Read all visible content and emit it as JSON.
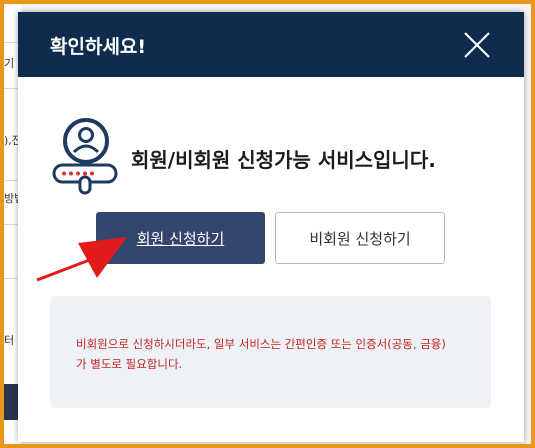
{
  "background_page": {
    "fragments": [
      "기",
      "),잔",
      "방법",
      "터"
    ]
  },
  "modal": {
    "title": "확인하세요!",
    "close_icon": "close-x-icon",
    "hero_icon": "user-password-icon",
    "message": "회원/비회원 신청가능 서비스입니다.",
    "buttons": {
      "member": "회원 신청하기",
      "guest": "비회원 신청하기"
    },
    "notice_lines": [
      "비회원으로 신청하시더라도, 일부 서비스는 간편인증 또는 인증서(공동, 금융)",
      "가 별도로 필요합니다."
    ]
  },
  "annotation": {
    "arrow_icon": "red-pointer-arrow",
    "arrow_color": "#e11b1b"
  },
  "colors": {
    "header_bg": "#0e2d4e",
    "primary_button": "#34466e",
    "notice_bg": "#eef1f6",
    "notice_text": "#c32424",
    "frame": "#e8971d"
  }
}
